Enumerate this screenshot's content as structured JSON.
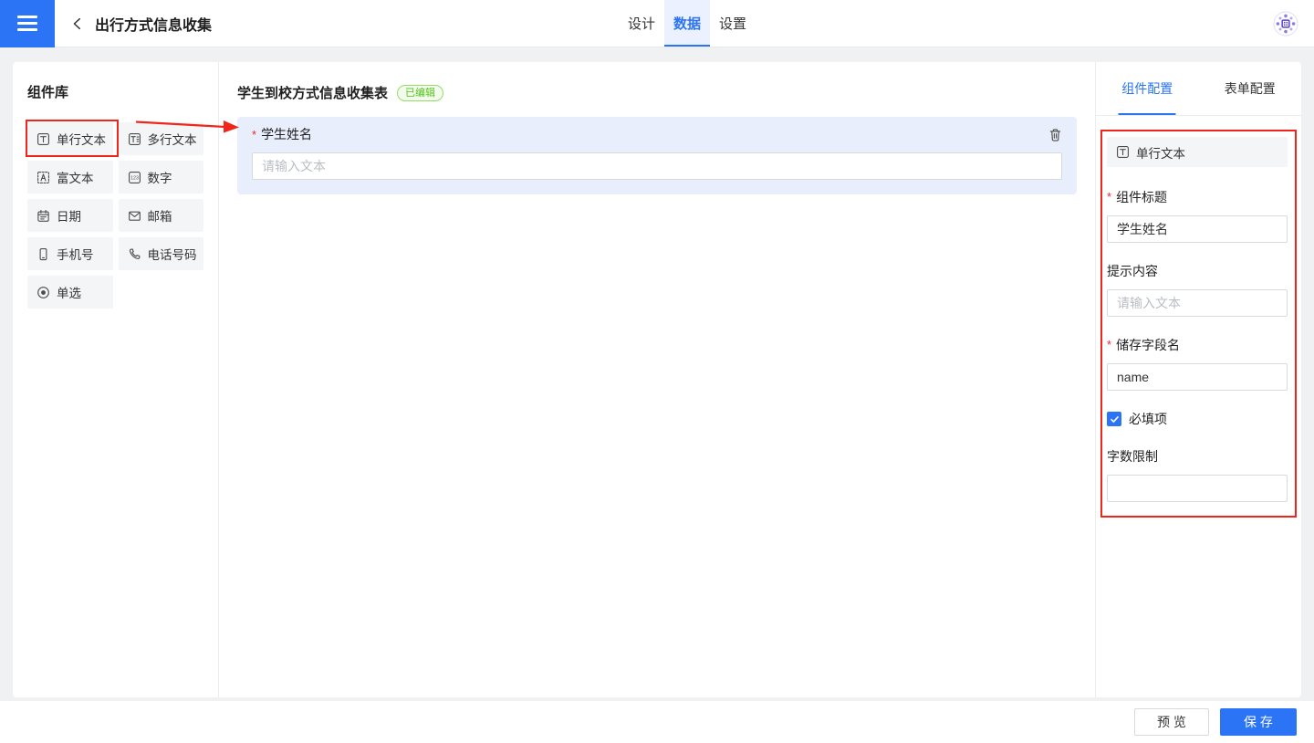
{
  "required_marker": "*",
  "topbar": {
    "title": "出行方式信息收集",
    "tabs": {
      "design": "设计",
      "data": "数据",
      "settings": "设置"
    },
    "active_tab": "数据"
  },
  "sidebar": {
    "title": "组件库",
    "items": [
      {
        "label": "单行文本",
        "icon": "single-line-text-icon",
        "highlighted": true
      },
      {
        "label": "多行文本",
        "icon": "multiline-text-icon",
        "highlighted": false
      },
      {
        "label": "富文本",
        "icon": "rich-text-icon",
        "highlighted": false
      },
      {
        "label": "数字",
        "icon": "number-icon",
        "highlighted": false
      },
      {
        "label": "日期",
        "icon": "date-icon",
        "highlighted": false
      },
      {
        "label": "邮箱",
        "icon": "email-icon",
        "highlighted": false
      },
      {
        "label": "手机号",
        "icon": "mobile-phone-icon",
        "highlighted": false
      },
      {
        "label": "电话号码",
        "icon": "telephone-icon",
        "highlighted": false
      },
      {
        "label": "单选",
        "icon": "radio-icon",
        "highlighted": false
      }
    ]
  },
  "canvas": {
    "form_title": "学生到校方式信息收集表",
    "status_badge": "已编辑",
    "field": {
      "label": "学生姓名",
      "required": true,
      "placeholder": "请输入文本"
    }
  },
  "config": {
    "tab_component": "组件配置",
    "tab_form": "表单配置",
    "active_tab": "组件配置",
    "component_type": "单行文本",
    "title_label": "组件标题",
    "title_value": "学生姓名",
    "hint_label": "提示内容",
    "hint_placeholder": "请输入文本",
    "field_name_label": "储存字段名",
    "field_name_value": "name",
    "required_checkbox_label": "必填项",
    "required_checked": true,
    "char_limit_label": "字数限制",
    "char_limit_value": ""
  },
  "footer": {
    "preview": "预 览",
    "save": "保 存"
  },
  "colors": {
    "accent": "#2b74f5",
    "annotation_red": "#f0261c",
    "badge_green": "#52c41a",
    "field_card_blue": "#e8eefb"
  }
}
